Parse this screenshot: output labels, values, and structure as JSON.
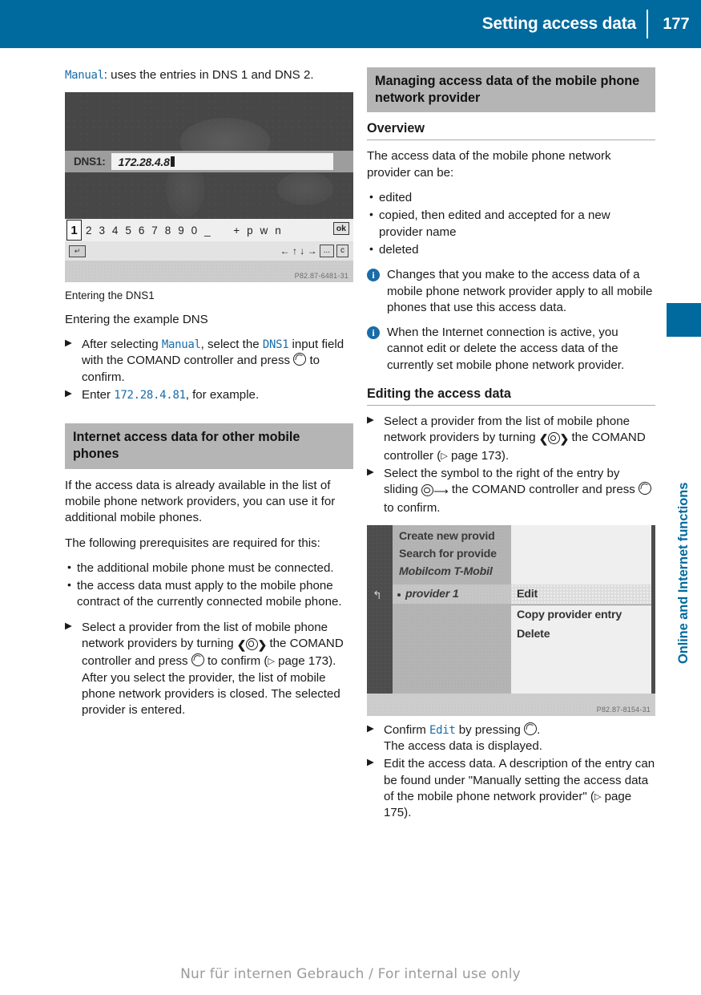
{
  "header": {
    "title": "Setting access data",
    "page_number": "177"
  },
  "side_tab": {
    "label": "Online and Internet functions"
  },
  "footer": {
    "text": "Nur für internen Gebrauch / For internal use only"
  },
  "left_column": {
    "manual_note": {
      "code": "Manual",
      "text": ": uses the entries in DNS 1 and DNS 2."
    },
    "figure1": {
      "label": "DNS1:",
      "value": "172.28.4.8",
      "key_selected": "1",
      "keys": "2 3 4 5 6 7 8 9 0 _",
      "keys2": "+ p w n",
      "ok_label": "ok",
      "back_icon": "↵",
      "nav_icons": "← ↑ ↓ →",
      "nav_box1": "...",
      "nav_box2": "c",
      "image_code": "P82.87-6481-31",
      "caption": "Entering the DNS1"
    },
    "heading_example": "Entering the example DNS",
    "steps1": [
      {
        "pre": "After selecting ",
        "code1": "Manual",
        "mid": ", select the ",
        "code2": "DNS1",
        "post": " input field with the COMAND controller and press ",
        "end": " to confirm."
      },
      {
        "pre": "Enter ",
        "code1": "172.28.4.81",
        "post": ", for example."
      }
    ],
    "section_heading": "Internet access data for other mobile phones",
    "paragraphs": [
      "If the access data is already available in the list of mobile phone network providers, you can use it for additional mobile phones.",
      "The following prerequisites are required for this:"
    ],
    "bullets": [
      "the additional mobile phone must be connected.",
      "the access data must apply to the mobile phone contract of the currently connected mobile phone."
    ],
    "step_select_provider": {
      "pre": "Select a provider from the list of mobile phone network providers by turning ",
      "mid": " the COMAND controller and press ",
      "post": " to confirm (",
      "ref": " page 173).",
      "follow": "After you select the provider, the list of mobile phone network providers is closed. The selected provider is entered."
    }
  },
  "right_column": {
    "section_heading": "Managing access data of the mobile phone network provider",
    "overview_heading": "Overview",
    "overview_intro": "The access data of the mobile phone network provider can be:",
    "overview_bullets": [
      "edited",
      "copied, then edited and accepted for a new provider name",
      "deleted"
    ],
    "notes": [
      "Changes that you make to the access data of a mobile phone network provider apply to all mobile phones that use this access data.",
      "When the Internet connection is active, you cannot edit or delete the access data of the currently set mobile phone network provider."
    ],
    "editing_heading": "Editing the access data",
    "steps": {
      "step1_pre": "Select a provider from the list of mobile phone network providers by turning ",
      "step1_mid": " the COMAND controller (",
      "step1_ref": " page 173).",
      "step2_pre": "Select the symbol to the right of the entry by sliding ",
      "step2_mid": " the COMAND controller and press ",
      "step2_post": " to confirm."
    },
    "figure2": {
      "items": [
        "Create new provid",
        "Search for provide",
        "Mobilcom T-Mobil",
        "provider 1"
      ],
      "menu_items": [
        "Edit",
        "Copy provider entry",
        "Delete"
      ],
      "back_icon": "↰",
      "image_code": "P82.87-8154-31"
    },
    "final_steps": {
      "confirm_pre": "Confirm ",
      "confirm_code": "Edit",
      "confirm_mid": " by pressing ",
      "confirm_post": ".",
      "confirm_follow": "The access data is displayed.",
      "edit_pre": "Edit the access data. A description of the entry can be found under \"Manually setting the access data of the mobile phone network provider\" (",
      "edit_ref": " page 175)."
    }
  }
}
